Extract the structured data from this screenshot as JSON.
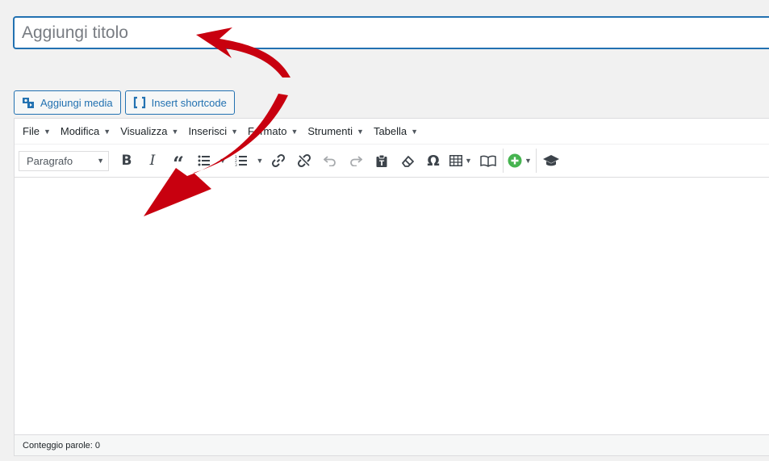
{
  "title": {
    "placeholder": "Aggiungi titolo",
    "value": ""
  },
  "media_buttons": {
    "add_media": "Aggiungi media",
    "insert_shortcode": "Insert shortcode"
  },
  "menubar": {
    "items": [
      "File",
      "Modifica",
      "Visualizza",
      "Inserisci",
      "Formato",
      "Strumenti",
      "Tabella"
    ]
  },
  "toolbar": {
    "format_select": "Paragrafo",
    "icons": [
      "bold-icon",
      "italic-icon",
      "blockquote-icon",
      "bullet-list-icon",
      "numbered-list-icon",
      "link-icon",
      "unlink-icon",
      "undo-icon",
      "redo-icon",
      "paste-text-icon",
      "clear-formatting-icon",
      "special-character-icon",
      "table-icon",
      "book-icon",
      "add-plus-icon",
      "graduation-cap-icon"
    ]
  },
  "status": {
    "word_count": "Conteggio parole: 0"
  },
  "colors": {
    "accent": "#2271b1",
    "arrow": "#c8000f",
    "plus": "#46b450"
  }
}
